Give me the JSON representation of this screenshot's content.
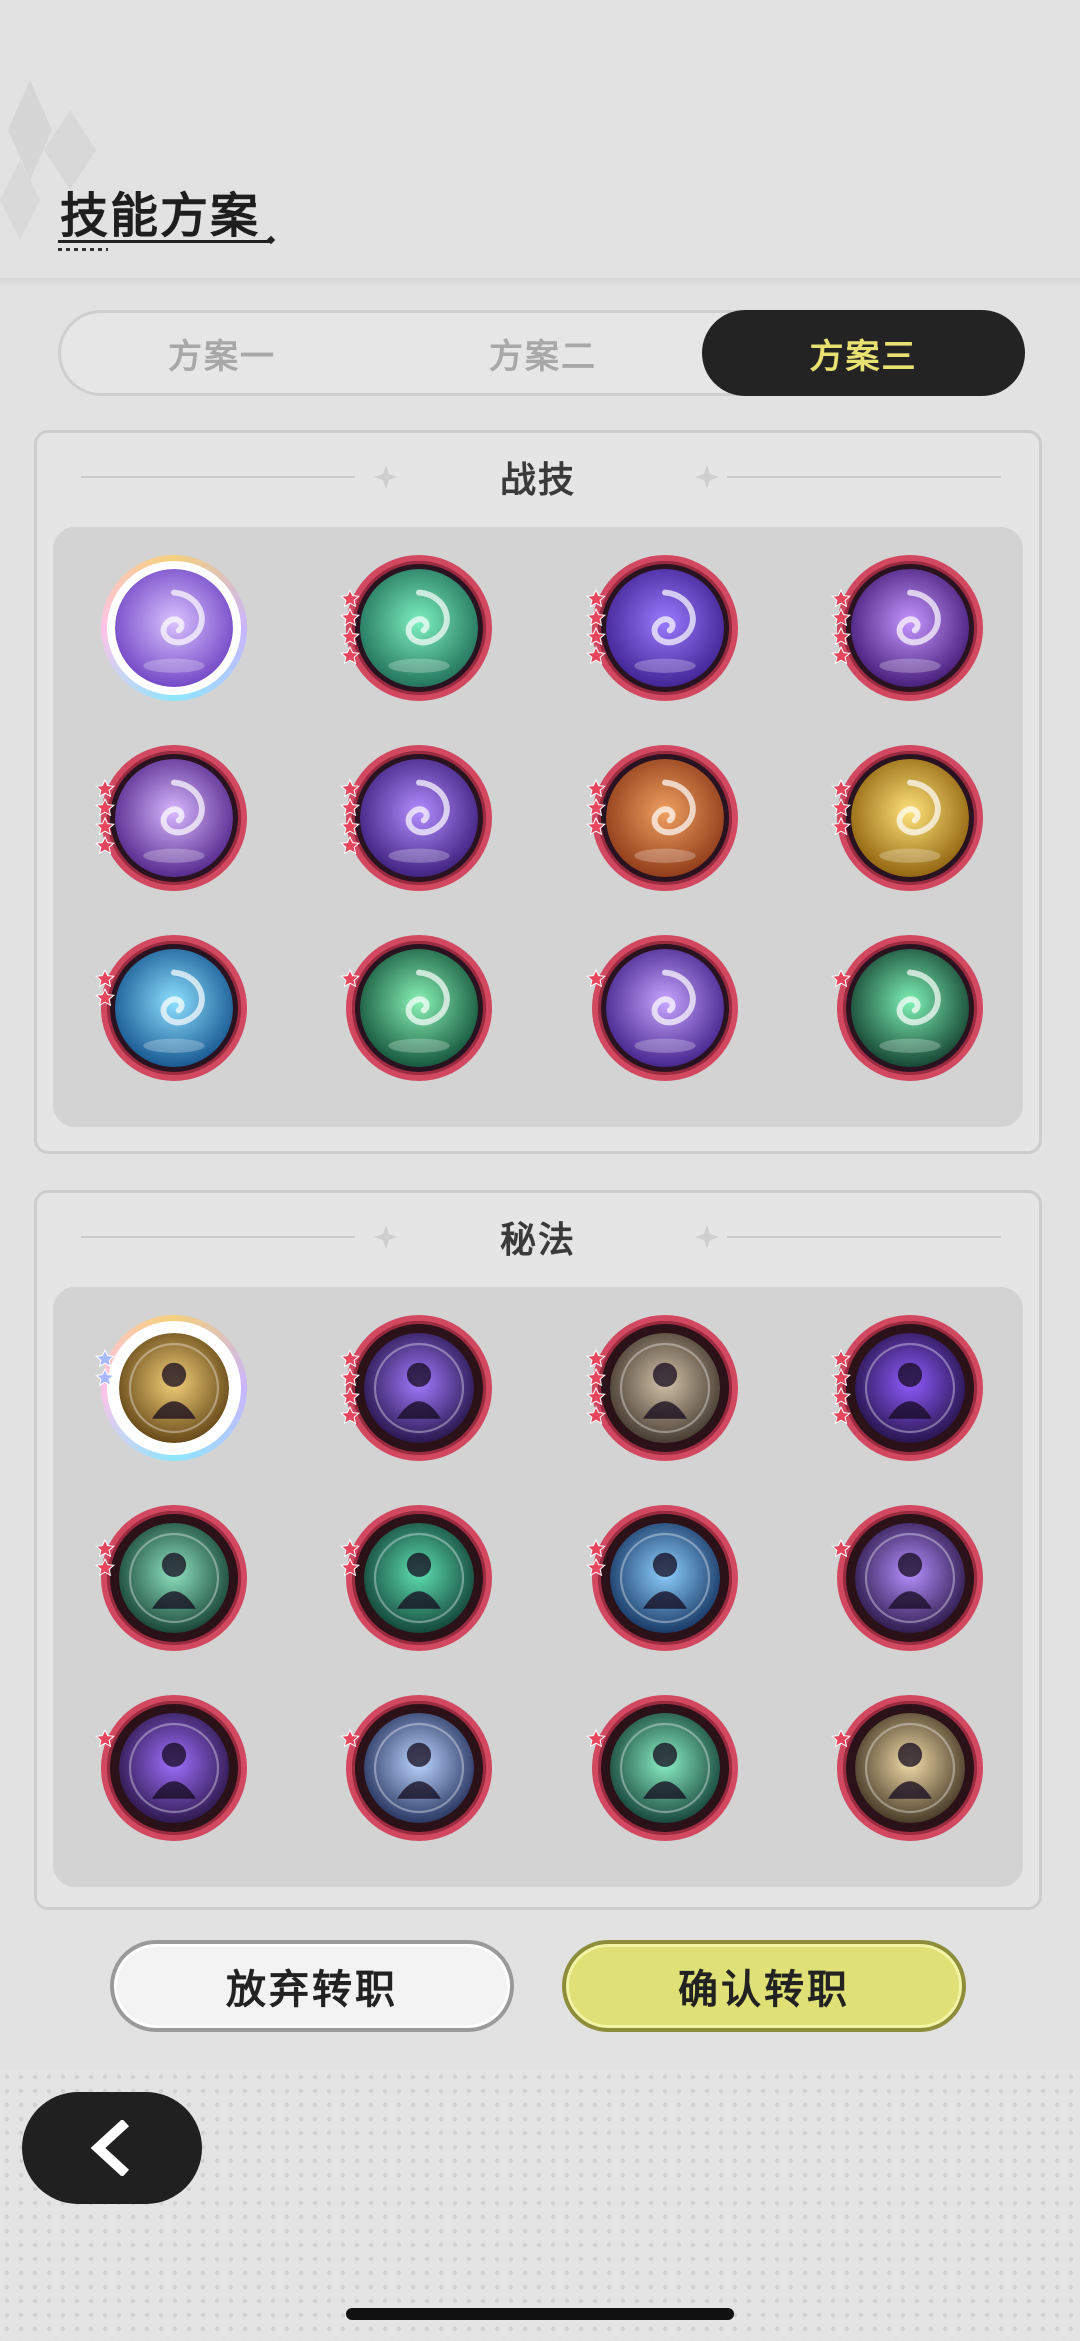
{
  "header": {
    "title": "技能方案"
  },
  "tabs": [
    {
      "label": "方案一",
      "active": false
    },
    {
      "label": "方案二",
      "active": false
    },
    {
      "label": "方案三",
      "active": true
    }
  ],
  "combat_skills": {
    "title": "战技",
    "icons": [
      {
        "name": "purple-throne-skill",
        "stars": 0,
        "rainbow": true,
        "colors": [
          "#6b3fc1",
          "#d9c2ff"
        ]
      },
      {
        "name": "green-meditation-skill",
        "stars": 4,
        "colors": [
          "#1c6a53",
          "#7df0c0"
        ]
      },
      {
        "name": "purple-vortex-skill",
        "stars": 4,
        "colors": [
          "#3b1e8c",
          "#9a7bff"
        ]
      },
      {
        "name": "purple-star-burst-skill",
        "stars": 4,
        "colors": [
          "#3d1670",
          "#c596ff"
        ]
      },
      {
        "name": "purple-spiral-flame-skill",
        "stars": 4,
        "colors": [
          "#4b1f84",
          "#d8b8ff"
        ]
      },
      {
        "name": "purple-shield-skill",
        "stars": 4,
        "colors": [
          "#371a76",
          "#b28dff"
        ]
      },
      {
        "name": "orange-shrine-skill",
        "stars": 3,
        "colors": [
          "#8a3515",
          "#f0a060"
        ]
      },
      {
        "name": "golden-guardian-skill",
        "stars": 3,
        "colors": [
          "#8a5c08",
          "#ffe37a"
        ]
      },
      {
        "name": "blue-creature-skill",
        "stars": 2,
        "colors": [
          "#0f4f8a",
          "#8de0ff"
        ]
      },
      {
        "name": "green-comet-skill",
        "stars": 1,
        "colors": [
          "#0d4c35",
          "#8af2b6"
        ]
      },
      {
        "name": "purple-swirl-skill",
        "stars": 1,
        "colors": [
          "#3c1d85",
          "#c7a4ff"
        ]
      },
      {
        "name": "green-bubbles-skill",
        "stars": 1,
        "colors": [
          "#0f3a2a",
          "#7ef0b5"
        ]
      }
    ]
  },
  "secret_arts": {
    "title": "秘法",
    "icons": [
      {
        "name": "golden-figure-art",
        "stars": 2,
        "rainbow": true,
        "star_color": "#a9b9ff",
        "colors": [
          "#5a3e10",
          "#f3cf7a"
        ]
      },
      {
        "name": "purple-orb-art",
        "stars": 4,
        "colors": [
          "#1f0f3f",
          "#a27bff"
        ]
      },
      {
        "name": "sepia-figure-art",
        "stars": 4,
        "colors": [
          "#3b3128",
          "#d2c2a8"
        ]
      },
      {
        "name": "purple-flex-art",
        "stars": 4,
        "colors": [
          "#1f0f3f",
          "#8f5cff"
        ]
      },
      {
        "name": "green-shield-art",
        "stars": 2,
        "colors": [
          "#103a2e",
          "#8fe2bf"
        ]
      },
      {
        "name": "green-figure-art",
        "stars": 2,
        "colors": [
          "#0e3a2f",
          "#5fe0b2"
        ]
      },
      {
        "name": "blue-figure-art",
        "stars": 2,
        "colors": [
          "#0f2d5a",
          "#8fd0ff"
        ]
      },
      {
        "name": "purple-flower-art",
        "stars": 1,
        "colors": [
          "#24123f",
          "#b590ff"
        ]
      },
      {
        "name": "purple-heart-art",
        "stars": 1,
        "colors": [
          "#24123f",
          "#a070ff"
        ]
      },
      {
        "name": "blue-crystal-art",
        "stars": 1,
        "colors": [
          "#1d2a55",
          "#bcd6ff"
        ]
      },
      {
        "name": "green-gem-art",
        "stars": 1,
        "colors": [
          "#0f3a30",
          "#8cf0c6"
        ]
      },
      {
        "name": "gold-arrow-art",
        "stars": 1,
        "colors": [
          "#3a2e1e",
          "#f2dcaa"
        ]
      }
    ]
  },
  "buttons": {
    "abandon": "放弃转职",
    "confirm": "确认转职"
  },
  "nav": {
    "back_icon": "chevron-left-icon"
  },
  "colors": {
    "accent_yellow": "#e9e072",
    "ring_red": "#d24861",
    "dark": "#232323",
    "star_red": "#e5465d"
  }
}
